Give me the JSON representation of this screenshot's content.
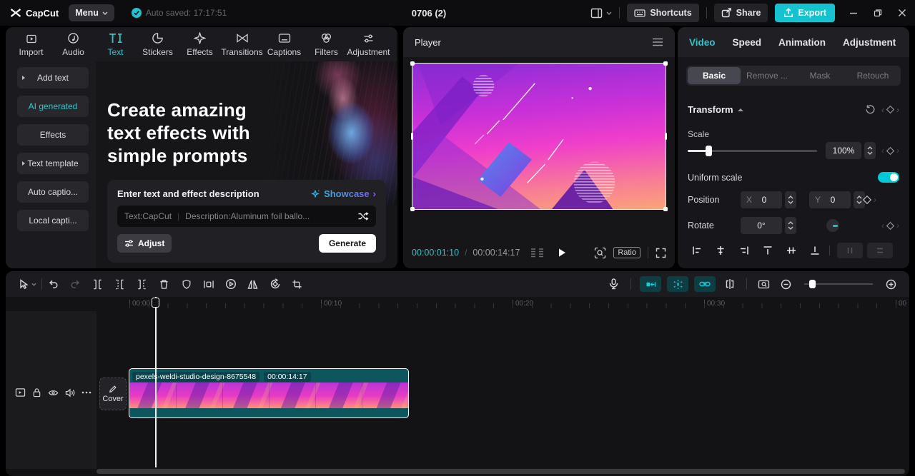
{
  "titlebar": {
    "app_name": "CapCut",
    "menu_label": "Menu",
    "autosave_text": "Auto saved: 17:17:51",
    "project_title": "0706 (2)",
    "shortcuts_label": "Shortcuts",
    "share_label": "Share",
    "export_label": "Export"
  },
  "media_toolbar": {
    "items": [
      {
        "label": "Import"
      },
      {
        "label": "Audio"
      },
      {
        "label": "Text",
        "selected": true
      },
      {
        "label": "Stickers"
      },
      {
        "label": "Effects"
      },
      {
        "label": "Transitions"
      },
      {
        "label": "Captions"
      },
      {
        "label": "Filters"
      },
      {
        "label": "Adjustment"
      }
    ]
  },
  "sidebar": {
    "items": [
      {
        "label": "Add text",
        "expandable": true
      },
      {
        "label": "AI generated",
        "selected": true
      },
      {
        "label": "Effects"
      },
      {
        "label": "Text template",
        "expandable": true
      },
      {
        "label": "Auto captio..."
      },
      {
        "label": "Local capti..."
      }
    ]
  },
  "promo": {
    "headline_line1": "Create amazing",
    "headline_line2": "text effects with",
    "headline_line3": "simple prompts",
    "prompt_label": "Enter text and effect description",
    "showcase_label": "Showcase",
    "showcase_chevron": "›",
    "input_text": "Text:CapCut",
    "input_divider": "|",
    "input_description": "Description:Aluminum foil ballo...",
    "adjust_label": "Adjust",
    "generate_label": "Generate"
  },
  "player": {
    "title": "Player",
    "current_time": "00:00:01:10",
    "time_separator": "/",
    "total_time": "00:00:14:17",
    "ratio_label": "Ratio"
  },
  "inspector": {
    "tabs": [
      {
        "label": "Video",
        "selected": true
      },
      {
        "label": "Speed"
      },
      {
        "label": "Animation"
      },
      {
        "label": "Adjustment"
      }
    ],
    "subtabs": [
      {
        "label": "Basic",
        "selected": true
      },
      {
        "label": "Remove ..."
      },
      {
        "label": "Mask"
      },
      {
        "label": "Retouch"
      }
    ],
    "transform": {
      "title": "Transform",
      "scale_label": "Scale",
      "scale_value": "100%",
      "uniform_scale_label": "Uniform scale",
      "uniform_scale_on": true,
      "position_label": "Position",
      "x_label": "X",
      "x_value": "0",
      "y_label": "Y",
      "y_value": "0",
      "rotate_label": "Rotate",
      "rotate_value": "0°"
    }
  },
  "timeline": {
    "ruler_labels": [
      "00:00",
      "00:10",
      "00:20",
      "00:30",
      "00"
    ],
    "clip": {
      "name": "pexels-weldi-studio-design-8675548",
      "duration": "00:00:14:17"
    },
    "cover_label": "Cover"
  },
  "colors": {
    "accent_teal": "#2ec6ce",
    "export_button": "#14c3cf",
    "toggle_on": "#00c8d6",
    "clip_teal": "#0d565e",
    "timecode_current": "#2ec6ce"
  }
}
